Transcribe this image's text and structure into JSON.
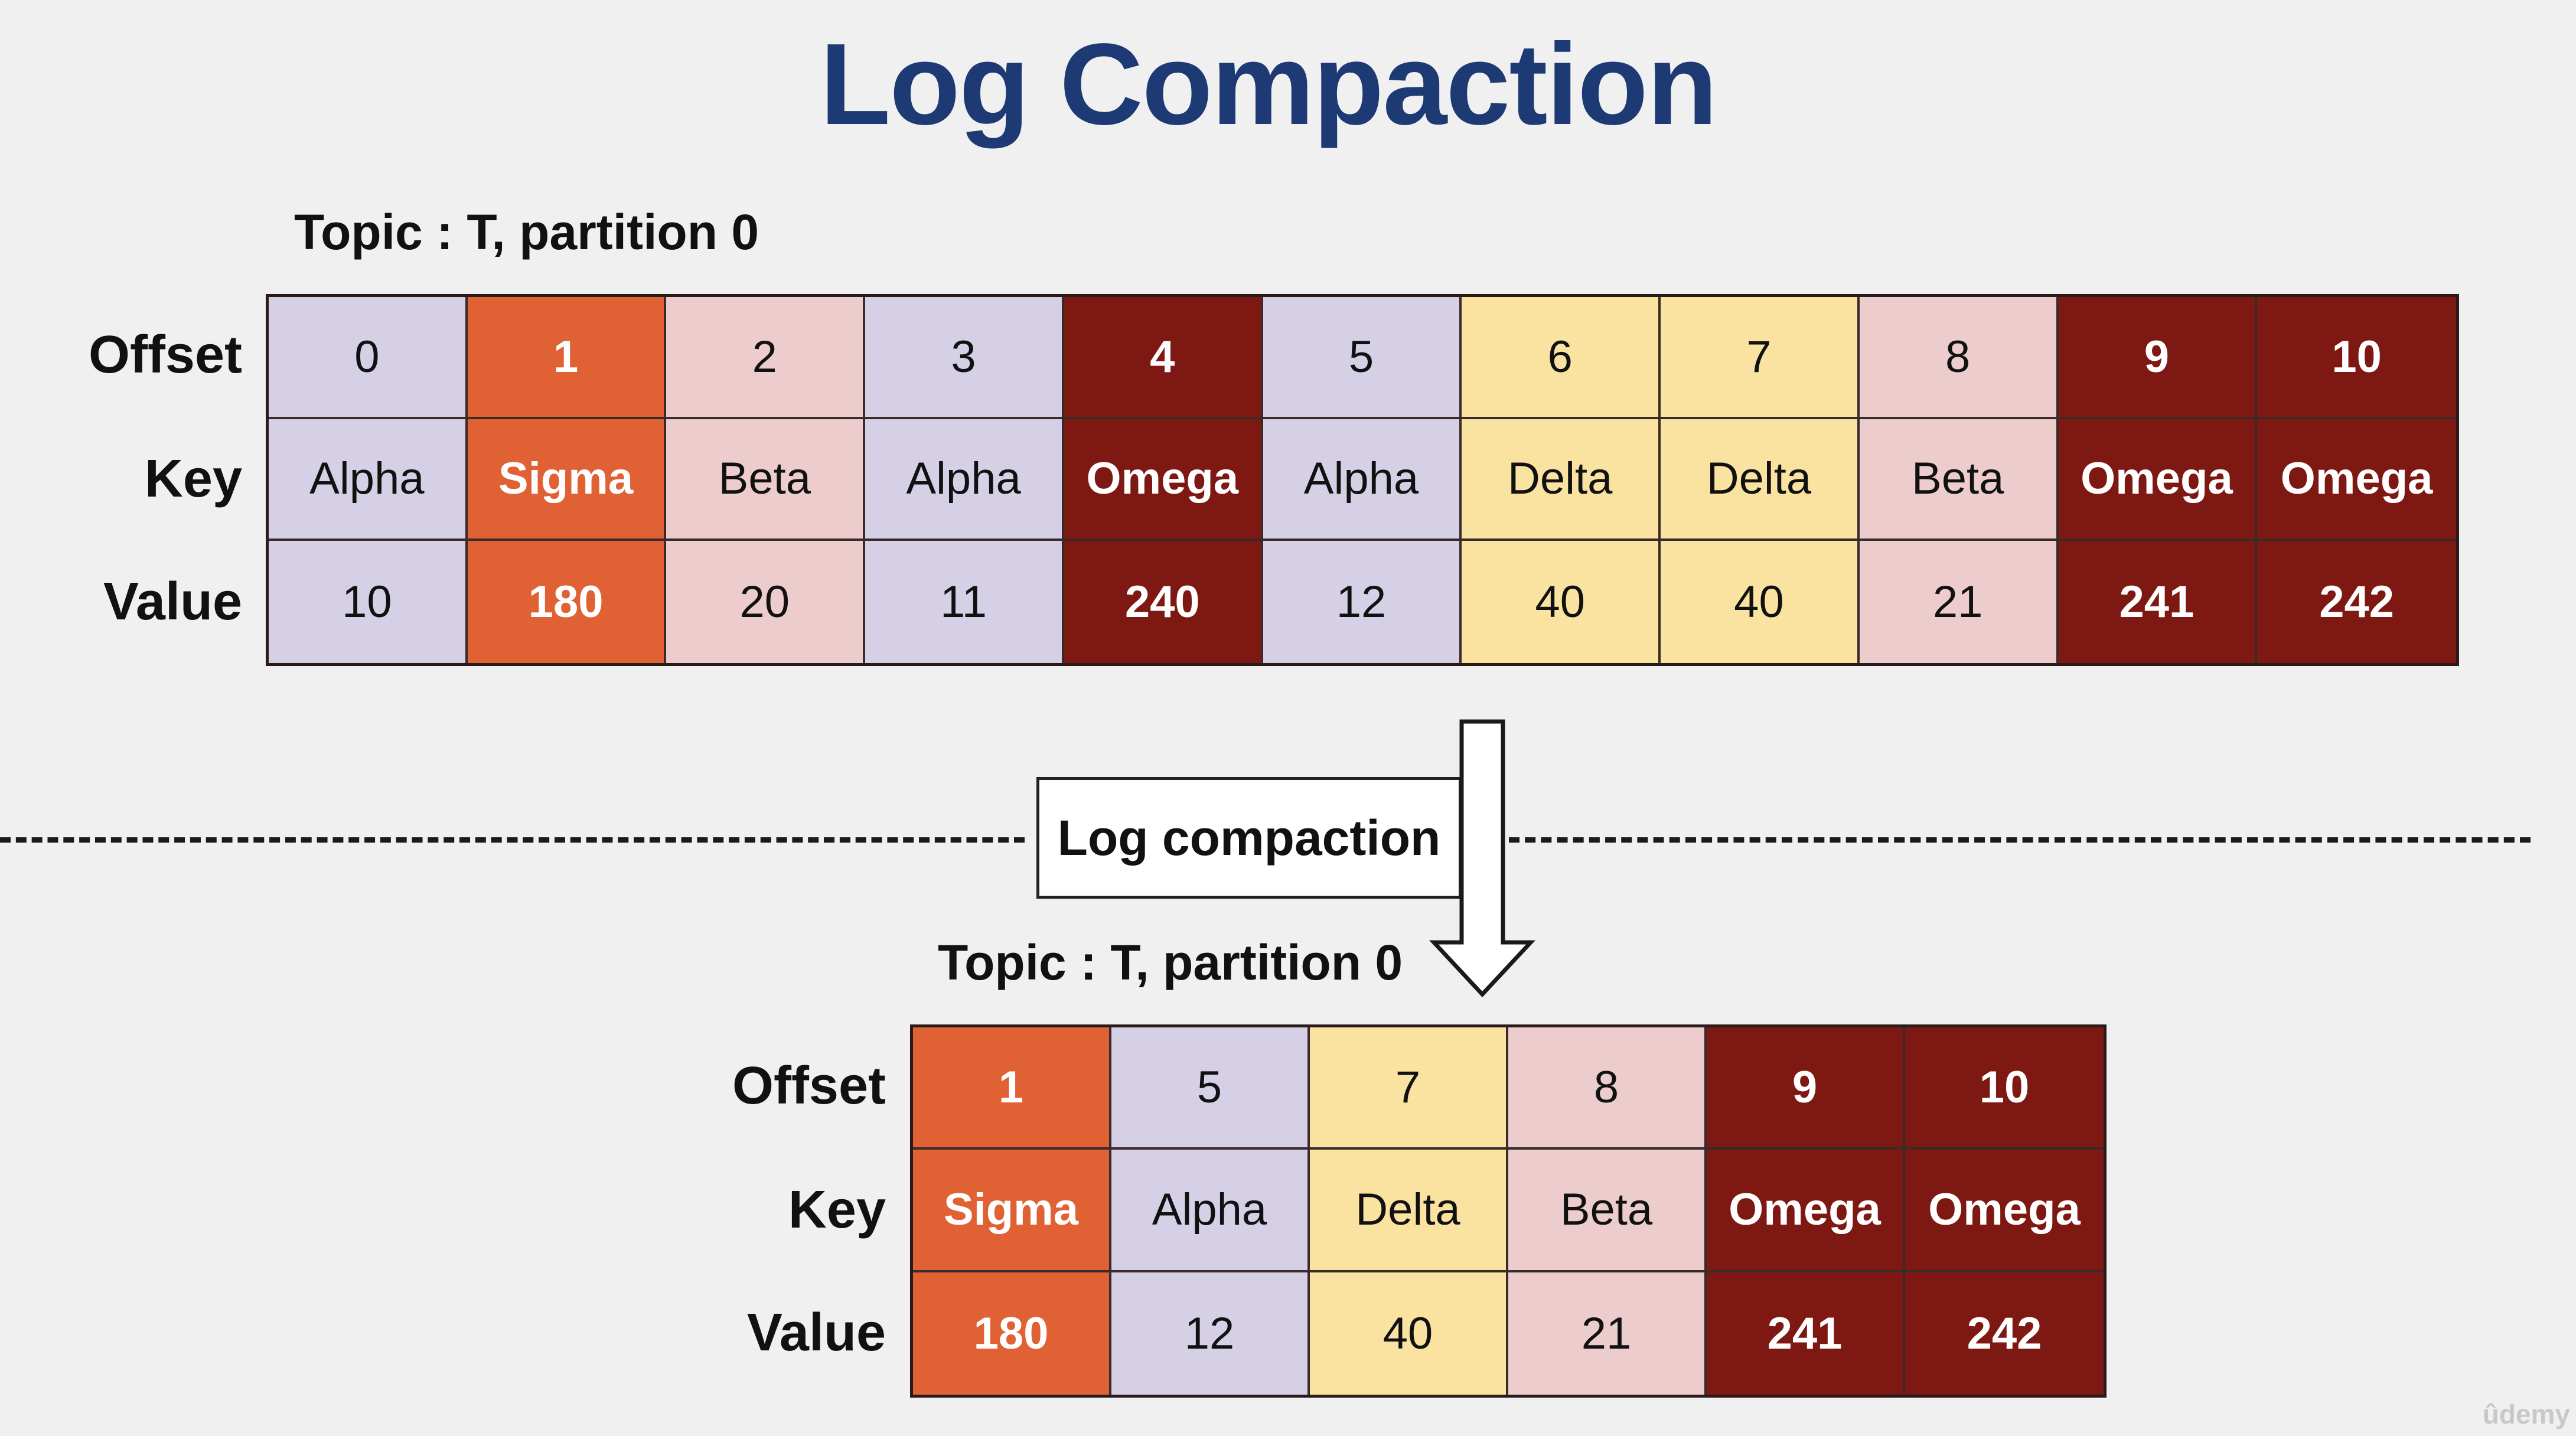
{
  "title": "Log Compaction",
  "colors": {
    "lavender": "#d6d0e6",
    "orange": "#e06134",
    "pink": "#eccccc",
    "darkred": "#7e1812",
    "yellow": "#fae3a0",
    "title_blue": "#1e3a74"
  },
  "row_labels": {
    "offset": "Offset",
    "key": "Key",
    "value": "Value"
  },
  "before": {
    "topic_label": "Topic : T, partition 0",
    "records": [
      {
        "offset": "0",
        "key": "Alpha",
        "value": "10",
        "color": "lavender"
      },
      {
        "offset": "1",
        "key": "Sigma",
        "value": "180",
        "color": "orange"
      },
      {
        "offset": "2",
        "key": "Beta",
        "value": "20",
        "color": "pink"
      },
      {
        "offset": "3",
        "key": "Alpha",
        "value": "11",
        "color": "lavender"
      },
      {
        "offset": "4",
        "key": "Omega",
        "value": "240",
        "color": "darkred"
      },
      {
        "offset": "5",
        "key": "Alpha",
        "value": "12",
        "color": "lavender"
      },
      {
        "offset": "6",
        "key": "Delta",
        "value": "40",
        "color": "yellow"
      },
      {
        "offset": "7",
        "key": "Delta",
        "value": "40",
        "color": "yellow"
      },
      {
        "offset": "8",
        "key": "Beta",
        "value": "21",
        "color": "pink"
      },
      {
        "offset": "9",
        "key": "Omega",
        "value": "241",
        "color": "darkred"
      },
      {
        "offset": "10",
        "key": "Omega",
        "value": "242",
        "color": "darkred"
      }
    ]
  },
  "compaction_label": "Log compaction",
  "after": {
    "topic_label": "Topic : T, partition 0",
    "records": [
      {
        "offset": "1",
        "key": "Sigma",
        "value": "180",
        "color": "orange"
      },
      {
        "offset": "5",
        "key": "Alpha",
        "value": "12",
        "color": "lavender"
      },
      {
        "offset": "7",
        "key": "Delta",
        "value": "40",
        "color": "yellow"
      },
      {
        "offset": "8",
        "key": "Beta",
        "value": "21",
        "color": "pink"
      },
      {
        "offset": "9",
        "key": "Omega",
        "value": "241",
        "color": "darkred"
      },
      {
        "offset": "10",
        "key": "Omega",
        "value": "242",
        "color": "darkred"
      }
    ]
  },
  "watermark": "ûdemy"
}
